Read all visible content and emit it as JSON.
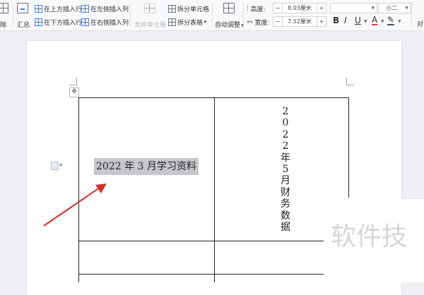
{
  "ribbon": {
    "delete_label": "删除",
    "delete_partial": "除",
    "summary_label": "汇总",
    "insert_above": "在上方插入行",
    "insert_below": "在下方插入行",
    "insert_left": "在左侧插入列",
    "insert_right": "在右侧插入列",
    "merge_cells": "合并单元格",
    "split_cells": "拆分单元格",
    "split_table": "拆分表格",
    "autofit": "自动调整",
    "height_label": "高度:",
    "height_value": "8.03厘米",
    "width_label": "宽度:",
    "width_value": "7.52厘米",
    "minus": "−",
    "plus": "+",
    "font_size": "小二",
    "bold": "B",
    "italic": "I",
    "underline": "U",
    "font_color": "A",
    "highlight": "✎",
    "more_right": "对"
  },
  "document": {
    "highlighted_text": "2022 年 3 月学习资料",
    "vertical_text": "2022年5月财务数据",
    "move_handle": "✥"
  },
  "watermark": "软件技",
  "colors": {
    "ribbon_bg": "#f8f9fa",
    "canvas_bg": "#eef0f3",
    "highlight_bg": "#c5c7cb",
    "arrow": "#d0302c",
    "table_border": "#222222"
  }
}
